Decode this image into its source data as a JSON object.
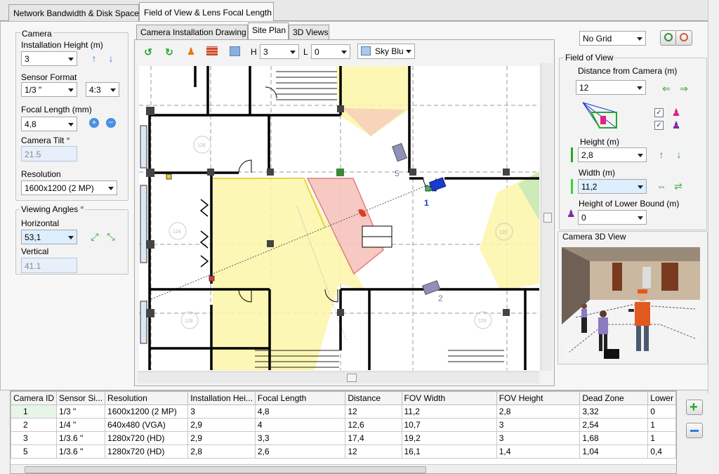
{
  "top_tabs": [
    "Network Bandwidth & Disk Space",
    "Field of View & Lens Focal Length"
  ],
  "camera": {
    "legend": "Camera",
    "installation_height_label": "Installation Height (m)",
    "installation_height": "3",
    "sensor_format_label": "Sensor Format",
    "sensor_format": "1/3 \"",
    "aspect_ratio": "4:3",
    "focal_length_label": "Focal Length (mm)",
    "focal_length": "4,8",
    "tilt_label": "Camera Tilt °",
    "tilt": "21.5",
    "resolution_label": "Resolution",
    "resolution": "1600x1200 (2 MP)"
  },
  "viewing_angles": {
    "legend": "Viewing Angles °",
    "horizontal_label": "Horizontal",
    "horizontal": "53,1",
    "vertical_label": "Vertical",
    "vertical": "41.1"
  },
  "inner_tabs": [
    "Camera Installation Drawing",
    "Site Plan",
    "3D Views"
  ],
  "toolbar": {
    "h_label": "H",
    "h_value": "3",
    "l_label": "L",
    "l_value": "0",
    "color_value": "Sky Blu",
    "color_hex": "#a8c8f0"
  },
  "plan": {
    "camera_labels": [
      "5",
      "1",
      "2"
    ],
    "room_tags": [
      "126",
      "124",
      "128",
      "129",
      "120"
    ]
  },
  "grid": {
    "value": "No Grid"
  },
  "fov": {
    "legend": "Field of View",
    "distance_label": "Distance from Camera  (m)",
    "distance": "12",
    "height_label": "Height (m)",
    "height": "2,8",
    "width_label": "Width (m)",
    "width": "11,2",
    "lower_bound_label": "Height of Lower Bound (m)",
    "lower_bound": "0"
  },
  "camera3d": {
    "label": "Camera 3D View",
    "index": "1"
  },
  "table": {
    "headers": [
      "Camera ID",
      "Sensor Si...",
      "Resolution",
      "Installation Hei...",
      "Focal Length",
      "Distance",
      "FOV Width",
      "FOV Height",
      "Dead Zone",
      "Lower"
    ],
    "rows": [
      [
        "1",
        "1/3 \"",
        "1600x1200 (2 MP)",
        "3",
        "4,8",
        "12",
        "11,2",
        "2,8",
        "3,32",
        "0"
      ],
      [
        "2",
        "1/4 \"",
        "640x480 (VGA)",
        "2,9",
        "4",
        "12,6",
        "10,7",
        "3",
        "2,54",
        "1"
      ],
      [
        "3",
        "1/3.6 \"",
        "1280x720 (HD)",
        "2,9",
        "3,3",
        "17,4",
        "19,2",
        "3",
        "1,68",
        "1"
      ],
      [
        "5",
        "1/3.6 \"",
        "1280x720 (HD)",
        "2,8",
        "2,6",
        "12",
        "16,1",
        "1,4",
        "1,04",
        "0,4"
      ]
    ]
  },
  "colors": {
    "accent_blue": "#2f7de0",
    "green": "#2aa52a",
    "pink": "#e0208a",
    "purple": "#7a2ab0"
  }
}
